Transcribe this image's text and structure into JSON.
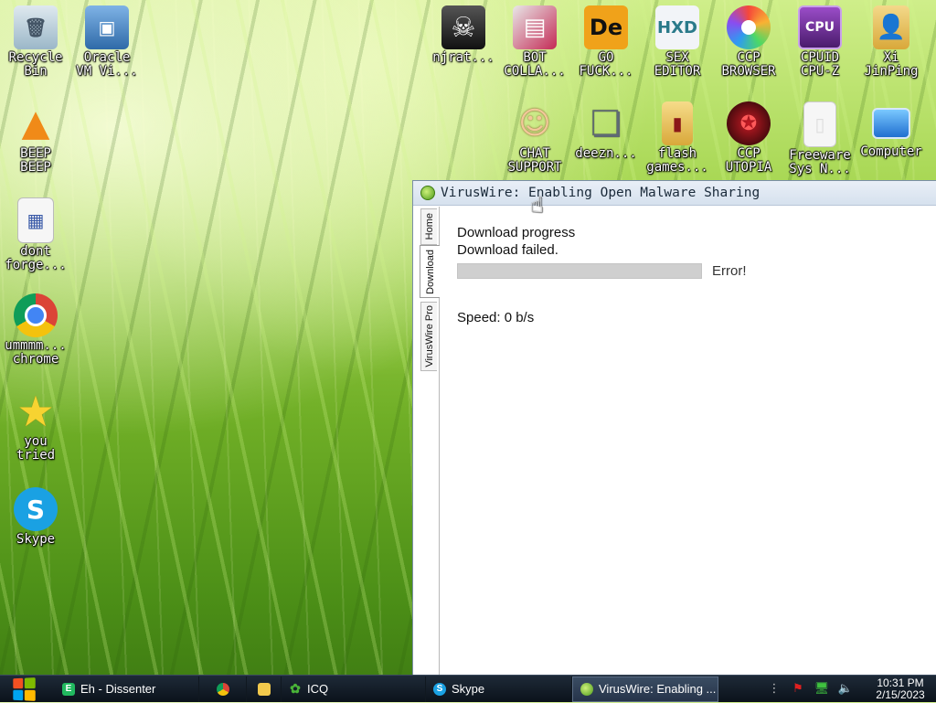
{
  "desktop": {
    "icons": [
      {
        "name": "recycle-bin-icon",
        "label": "Recycle\nBin",
        "color": "#9bb7c8",
        "glyph": "🗑"
      },
      {
        "name": "oracle-vm-icon",
        "label": "Oracle\nVM Vi...",
        "color": "#2f6aa8",
        "glyph": "▣"
      },
      {
        "name": "beep-beep-icon",
        "label": "BEEP\nBEEP",
        "color": "#f08a18",
        "glyph": "▲"
      },
      {
        "name": "dont-forget-icon",
        "label": "dont\nforge...",
        "color": "#f6f6f6",
        "glyph": "▦"
      },
      {
        "name": "chrome-icon",
        "label": "ummmm...\nchrome",
        "color": "#db4437",
        "glyph": "◉"
      },
      {
        "name": "star-icon",
        "label": "you\ntried",
        "color": "#f7d331",
        "glyph": "★"
      },
      {
        "name": "skype-icon",
        "label": "Skype",
        "color": "#1aa1e3",
        "glyph": "S"
      },
      {
        "name": "skull-icon",
        "label": "njrat...",
        "color": "#222222",
        "glyph": "☠"
      },
      {
        "name": "bot-collab-icon",
        "label": "BOT\nCOLLA...",
        "color": "#c42a55",
        "glyph": "▤"
      },
      {
        "name": "de-icon",
        "label": "GO\nFUCK...",
        "color": "#f0a21a",
        "glyph": "De"
      },
      {
        "name": "hxd-icon",
        "label": "SEX\nEDITOR",
        "color": "#e8ecf2",
        "glyph": "HXD"
      },
      {
        "name": "ccp-browser-icon",
        "label": "CCP\nBROWSER",
        "color": "#7b5cf0",
        "glyph": "✿"
      },
      {
        "name": "cpuz-icon",
        "label": "CPUID\nCPU-Z",
        "color": "#6a2c8c",
        "glyph": "CPU"
      },
      {
        "name": "xi-folder-icon",
        "label": "Xi\nJinPing",
        "color": "#e8c25a",
        "glyph": "👤"
      },
      {
        "name": "chat-support-icon",
        "label": "CHAT\nSUPPORT",
        "color": "#f3c89a",
        "glyph": "☺"
      },
      {
        "name": "deezn-icon",
        "label": "deezn...",
        "color": "#5f6a74",
        "glyph": "❏"
      },
      {
        "name": "flash-games-icon",
        "label": "flash\ngames...",
        "color": "#e9c35c",
        "glyph": "▮"
      },
      {
        "name": "ccp-utopia-icon",
        "label": "CCP\nUTOPIA",
        "color": "#8a0f18",
        "glyph": "✪"
      },
      {
        "name": "freeware-icon",
        "label": "Freeware\nSys N...",
        "color": "#f2f2f2",
        "glyph": "▯"
      },
      {
        "name": "computer-icon",
        "label": "Computer",
        "color": "#2f8fe0",
        "glyph": "▭"
      }
    ]
  },
  "window": {
    "title": "VirusWire: Enabling Open Malware Sharing",
    "tabs": [
      "Home",
      "Download",
      "VirusWire Pro"
    ],
    "heading": "Download progress",
    "status": "Download failed.",
    "progress_label": "Error!",
    "progress": 0,
    "speed": "Speed: 0 b/s"
  },
  "taskbar": {
    "items": [
      {
        "label": "Eh - Dissenter",
        "name": "taskbar-dissenter",
        "color": "#21b85f",
        "glyph": "E"
      },
      {
        "label": "",
        "name": "taskbar-chrome",
        "color": "#db4437",
        "glyph": "◉"
      },
      {
        "label": "",
        "name": "taskbar-explorer",
        "color": "#f2c94c",
        "glyph": "▇"
      },
      {
        "label": "ICQ",
        "name": "taskbar-icq",
        "color": "#49b338",
        "glyph": "✿"
      },
      {
        "label": "Skype",
        "name": "taskbar-skype",
        "color": "#1aa1e3",
        "glyph": "S"
      },
      {
        "label": "VirusWire: Enabling ...",
        "name": "taskbar-viruswire",
        "color": "#7ac43a",
        "glyph": "●"
      }
    ],
    "time": "10:31 PM",
    "date": "2/15/2023"
  },
  "colors": {
    "accent": "#1aa1e3",
    "win_green": "#4c9a1a"
  }
}
